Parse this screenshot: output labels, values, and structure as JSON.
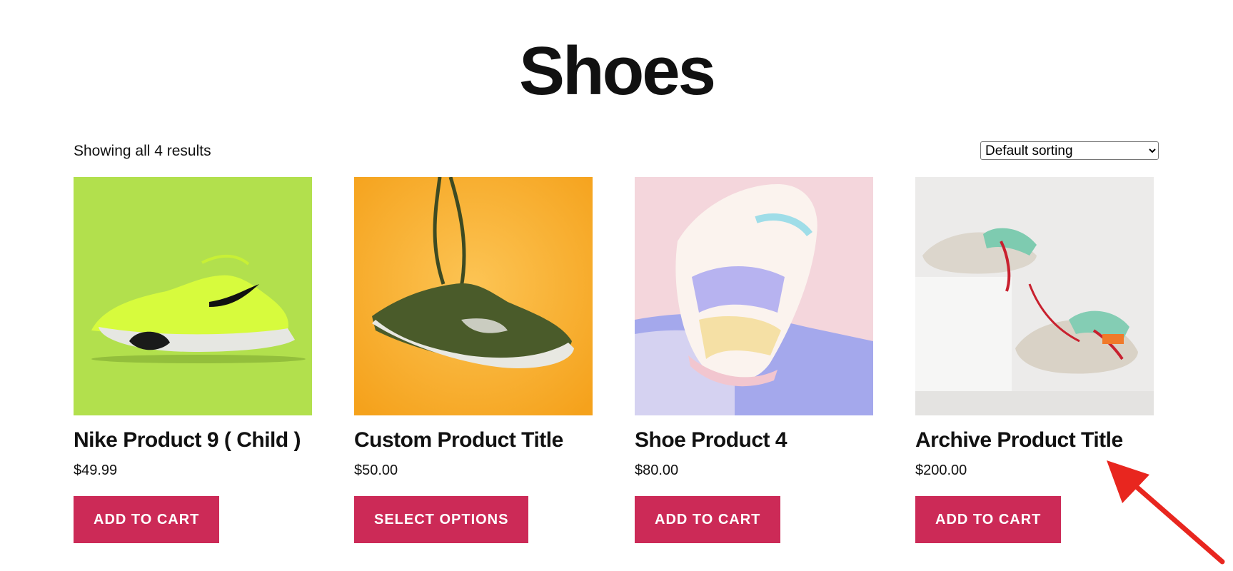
{
  "page": {
    "title": "Shoes",
    "result_count": "Showing all 4 results"
  },
  "sorting": {
    "selected": "Default sorting"
  },
  "products": [
    {
      "title": "Nike Product 9 ( Child )",
      "price": "$49.99",
      "button": "ADD TO CART",
      "image_bg": "#b2e04d"
    },
    {
      "title": "Custom Product Title",
      "price": "$50.00",
      "button": "SELECT OPTIONS",
      "image_bg": "#f8ae2e"
    },
    {
      "title": "Shoe Product 4",
      "price": "$80.00",
      "button": "ADD TO CART",
      "image_bg": "#f2d4da"
    },
    {
      "title": "Archive Product Title",
      "price": "$200.00",
      "button": "ADD TO CART",
      "image_bg": "#ecebea"
    }
  ],
  "colors": {
    "button_bg": "#cc2a57",
    "arrow": "#e8261f"
  },
  "annotation": {
    "icon": "red-arrow-icon"
  }
}
